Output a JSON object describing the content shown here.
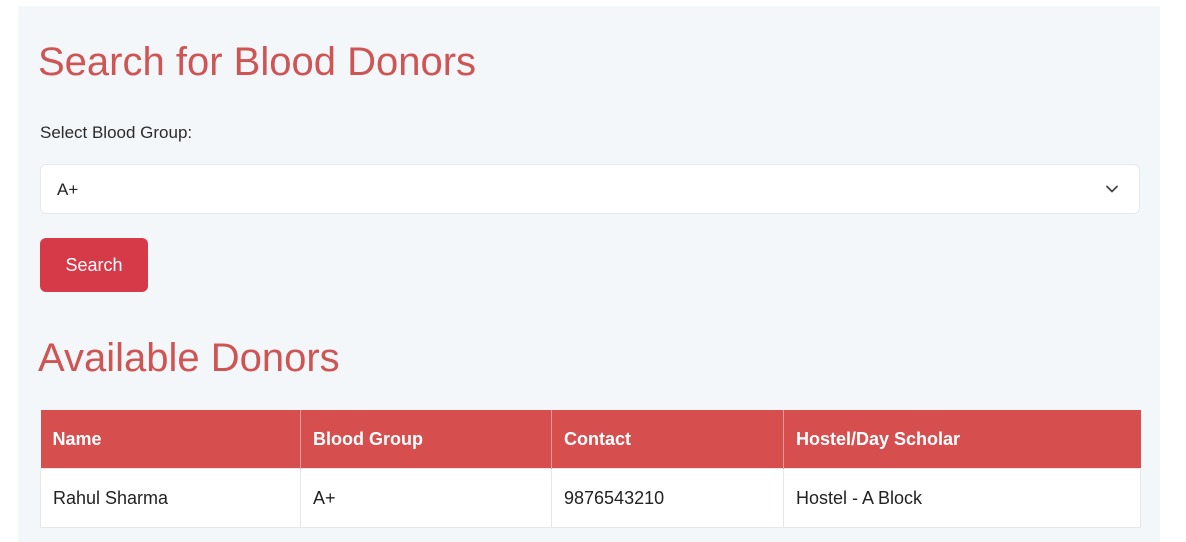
{
  "page": {
    "search_title": "Search for Blood Donors",
    "available_title": "Available Donors"
  },
  "search": {
    "select_label": "Select Blood Group:",
    "selected_value": "A+",
    "button_label": "Search"
  },
  "table": {
    "headers": [
      "Name",
      "Blood Group",
      "Contact",
      "Hostel/Day Scholar"
    ],
    "rows": [
      [
        "Rahul Sharma",
        "A+",
        "9876543210",
        "Hostel - A Block"
      ]
    ]
  },
  "colors": {
    "title": "#cf5454",
    "button": "#d63a48",
    "table_header": "#d64e4e"
  },
  "icons": {
    "select_arrow": "chevron-down-icon"
  }
}
